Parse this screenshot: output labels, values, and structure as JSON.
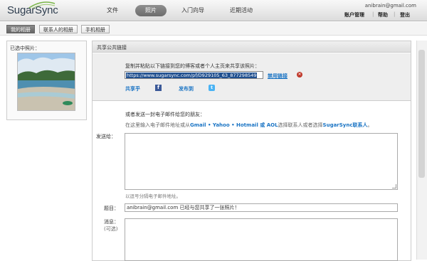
{
  "app": {
    "logo": "SugarSync"
  },
  "nav": {
    "items": [
      "文件",
      "照片",
      "入门向导",
      "近期活动"
    ],
    "active": "照片"
  },
  "account": {
    "email": "anibrain@gmail.com",
    "links": [
      "账户管理",
      "帮助",
      "登出"
    ]
  },
  "subtabs": [
    "我的相册",
    "联系人的相册",
    "手机相册"
  ],
  "left": {
    "label": "已选中照片："
  },
  "share": {
    "header": "共享公共链接",
    "instruction": "复制并粘贴以下链接到您的博客或者个人主页来共享该照片：",
    "url": "https://www.sugarsync.com/pf/D929105_63_877298549",
    "disable_link": "禁用链接",
    "sharer": "共享乎",
    "facebook": "f",
    "publish": "发布到",
    "twitter": "t"
  },
  "email": {
    "intro": "或者发送一封电子邮件给您的朋友：",
    "hint_prefix": "在这里输入电子邮件地址或从",
    "services": "Gmail • Yahoo • Hotmail 或 AOL",
    "hint_mid": "选择联系人或者选择",
    "contacts": "SugarSync联系人",
    "hint_suffix": "。",
    "to_label": "发送给：",
    "to_help": "以逗号分隔电子邮件地址。",
    "subject_label": "题目：",
    "subject_value": "anibrain@gmail.com 已经与您共享了一张照片！",
    "message_label": "消息：",
    "message_optional": "(可选)"
  }
}
